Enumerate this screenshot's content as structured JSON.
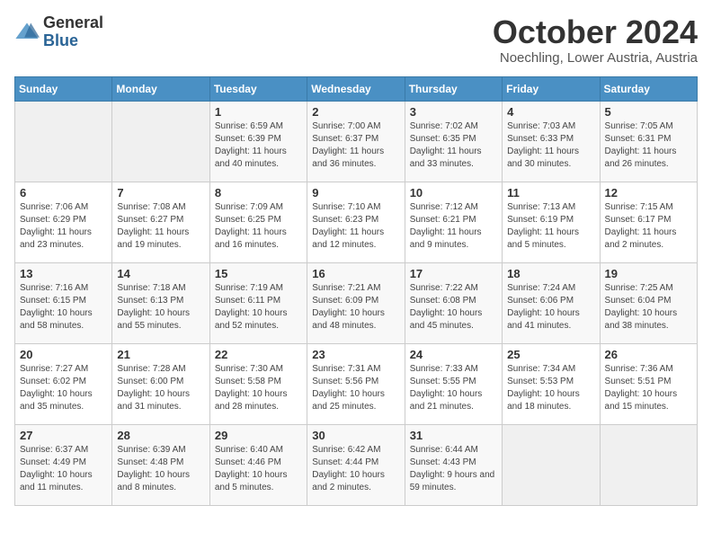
{
  "logo": {
    "general": "General",
    "blue": "Blue"
  },
  "header": {
    "month": "October 2024",
    "location": "Noechling, Lower Austria, Austria"
  },
  "weekdays": [
    "Sunday",
    "Monday",
    "Tuesday",
    "Wednesday",
    "Thursday",
    "Friday",
    "Saturday"
  ],
  "weeks": [
    [
      {
        "day": "",
        "sunrise": "",
        "sunset": "",
        "daylight": ""
      },
      {
        "day": "",
        "sunrise": "",
        "sunset": "",
        "daylight": ""
      },
      {
        "day": "1",
        "sunrise": "Sunrise: 6:59 AM",
        "sunset": "Sunset: 6:39 PM",
        "daylight": "Daylight: 11 hours and 40 minutes."
      },
      {
        "day": "2",
        "sunrise": "Sunrise: 7:00 AM",
        "sunset": "Sunset: 6:37 PM",
        "daylight": "Daylight: 11 hours and 36 minutes."
      },
      {
        "day": "3",
        "sunrise": "Sunrise: 7:02 AM",
        "sunset": "Sunset: 6:35 PM",
        "daylight": "Daylight: 11 hours and 33 minutes."
      },
      {
        "day": "4",
        "sunrise": "Sunrise: 7:03 AM",
        "sunset": "Sunset: 6:33 PM",
        "daylight": "Daylight: 11 hours and 30 minutes."
      },
      {
        "day": "5",
        "sunrise": "Sunrise: 7:05 AM",
        "sunset": "Sunset: 6:31 PM",
        "daylight": "Daylight: 11 hours and 26 minutes."
      }
    ],
    [
      {
        "day": "6",
        "sunrise": "Sunrise: 7:06 AM",
        "sunset": "Sunset: 6:29 PM",
        "daylight": "Daylight: 11 hours and 23 minutes."
      },
      {
        "day": "7",
        "sunrise": "Sunrise: 7:08 AM",
        "sunset": "Sunset: 6:27 PM",
        "daylight": "Daylight: 11 hours and 19 minutes."
      },
      {
        "day": "8",
        "sunrise": "Sunrise: 7:09 AM",
        "sunset": "Sunset: 6:25 PM",
        "daylight": "Daylight: 11 hours and 16 minutes."
      },
      {
        "day": "9",
        "sunrise": "Sunrise: 7:10 AM",
        "sunset": "Sunset: 6:23 PM",
        "daylight": "Daylight: 11 hours and 12 minutes."
      },
      {
        "day": "10",
        "sunrise": "Sunrise: 7:12 AM",
        "sunset": "Sunset: 6:21 PM",
        "daylight": "Daylight: 11 hours and 9 minutes."
      },
      {
        "day": "11",
        "sunrise": "Sunrise: 7:13 AM",
        "sunset": "Sunset: 6:19 PM",
        "daylight": "Daylight: 11 hours and 5 minutes."
      },
      {
        "day": "12",
        "sunrise": "Sunrise: 7:15 AM",
        "sunset": "Sunset: 6:17 PM",
        "daylight": "Daylight: 11 hours and 2 minutes."
      }
    ],
    [
      {
        "day": "13",
        "sunrise": "Sunrise: 7:16 AM",
        "sunset": "Sunset: 6:15 PM",
        "daylight": "Daylight: 10 hours and 58 minutes."
      },
      {
        "day": "14",
        "sunrise": "Sunrise: 7:18 AM",
        "sunset": "Sunset: 6:13 PM",
        "daylight": "Daylight: 10 hours and 55 minutes."
      },
      {
        "day": "15",
        "sunrise": "Sunrise: 7:19 AM",
        "sunset": "Sunset: 6:11 PM",
        "daylight": "Daylight: 10 hours and 52 minutes."
      },
      {
        "day": "16",
        "sunrise": "Sunrise: 7:21 AM",
        "sunset": "Sunset: 6:09 PM",
        "daylight": "Daylight: 10 hours and 48 minutes."
      },
      {
        "day": "17",
        "sunrise": "Sunrise: 7:22 AM",
        "sunset": "Sunset: 6:08 PM",
        "daylight": "Daylight: 10 hours and 45 minutes."
      },
      {
        "day": "18",
        "sunrise": "Sunrise: 7:24 AM",
        "sunset": "Sunset: 6:06 PM",
        "daylight": "Daylight: 10 hours and 41 minutes."
      },
      {
        "day": "19",
        "sunrise": "Sunrise: 7:25 AM",
        "sunset": "Sunset: 6:04 PM",
        "daylight": "Daylight: 10 hours and 38 minutes."
      }
    ],
    [
      {
        "day": "20",
        "sunrise": "Sunrise: 7:27 AM",
        "sunset": "Sunset: 6:02 PM",
        "daylight": "Daylight: 10 hours and 35 minutes."
      },
      {
        "day": "21",
        "sunrise": "Sunrise: 7:28 AM",
        "sunset": "Sunset: 6:00 PM",
        "daylight": "Daylight: 10 hours and 31 minutes."
      },
      {
        "day": "22",
        "sunrise": "Sunrise: 7:30 AM",
        "sunset": "Sunset: 5:58 PM",
        "daylight": "Daylight: 10 hours and 28 minutes."
      },
      {
        "day": "23",
        "sunrise": "Sunrise: 7:31 AM",
        "sunset": "Sunset: 5:56 PM",
        "daylight": "Daylight: 10 hours and 25 minutes."
      },
      {
        "day": "24",
        "sunrise": "Sunrise: 7:33 AM",
        "sunset": "Sunset: 5:55 PM",
        "daylight": "Daylight: 10 hours and 21 minutes."
      },
      {
        "day": "25",
        "sunrise": "Sunrise: 7:34 AM",
        "sunset": "Sunset: 5:53 PM",
        "daylight": "Daylight: 10 hours and 18 minutes."
      },
      {
        "day": "26",
        "sunrise": "Sunrise: 7:36 AM",
        "sunset": "Sunset: 5:51 PM",
        "daylight": "Daylight: 10 hours and 15 minutes."
      }
    ],
    [
      {
        "day": "27",
        "sunrise": "Sunrise: 6:37 AM",
        "sunset": "Sunset: 4:49 PM",
        "daylight": "Daylight: 10 hours and 11 minutes."
      },
      {
        "day": "28",
        "sunrise": "Sunrise: 6:39 AM",
        "sunset": "Sunset: 4:48 PM",
        "daylight": "Daylight: 10 hours and 8 minutes."
      },
      {
        "day": "29",
        "sunrise": "Sunrise: 6:40 AM",
        "sunset": "Sunset: 4:46 PM",
        "daylight": "Daylight: 10 hours and 5 minutes."
      },
      {
        "day": "30",
        "sunrise": "Sunrise: 6:42 AM",
        "sunset": "Sunset: 4:44 PM",
        "daylight": "Daylight: 10 hours and 2 minutes."
      },
      {
        "day": "31",
        "sunrise": "Sunrise: 6:44 AM",
        "sunset": "Sunset: 4:43 PM",
        "daylight": "Daylight: 9 hours and 59 minutes."
      },
      {
        "day": "",
        "sunrise": "",
        "sunset": "",
        "daylight": ""
      },
      {
        "day": "",
        "sunrise": "",
        "sunset": "",
        "daylight": ""
      }
    ]
  ]
}
